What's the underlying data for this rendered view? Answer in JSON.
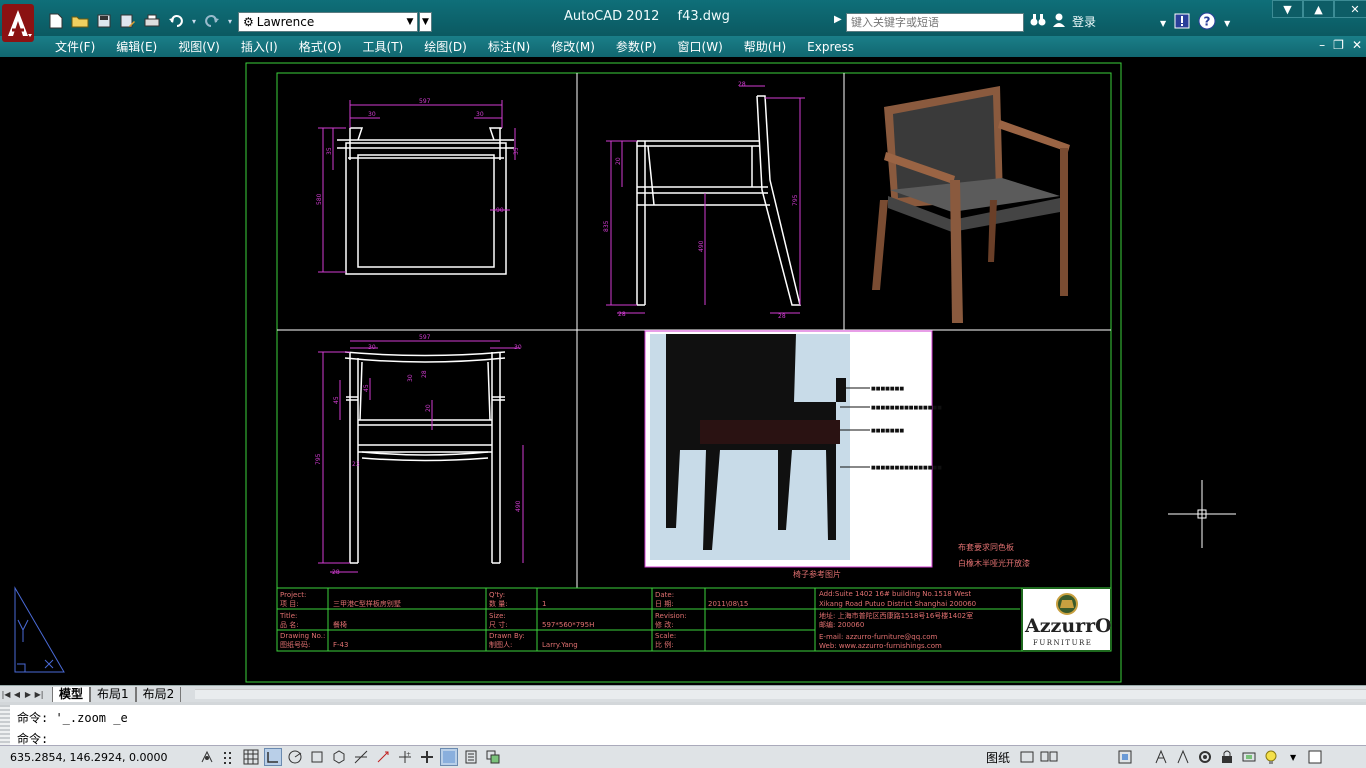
{
  "titlebar": {
    "app_name": "AutoCAD 2012",
    "file_name": "f43.dwg",
    "workspace": "Lawrence",
    "search_placeholder": "键入关键字或短语",
    "login_label": "登录"
  },
  "menu": {
    "items": [
      {
        "label": "文件(F)"
      },
      {
        "label": "编辑(E)"
      },
      {
        "label": "视图(V)"
      },
      {
        "label": "插入(I)"
      },
      {
        "label": "格式(O)"
      },
      {
        "label": "工具(T)"
      },
      {
        "label": "绘图(D)"
      },
      {
        "label": "标注(N)"
      },
      {
        "label": "修改(M)"
      },
      {
        "label": "参数(P)"
      },
      {
        "label": "窗口(W)"
      },
      {
        "label": "帮助(H)"
      },
      {
        "label": "Express"
      }
    ]
  },
  "drawing": {
    "dims": {
      "front_width": "597",
      "front_arm": "30",
      "front_side": "30",
      "front_height": "580",
      "front_top": "35",
      "front_right": "35",
      "front_inner": "90",
      "side_top": "28",
      "side_total": "835",
      "side_seat": "490",
      "side_right": "795",
      "side_upper": "20",
      "side_bottom1": "28",
      "side_bottom2": "28",
      "back_width": "597",
      "back_arm": "30",
      "back_right": "30",
      "back_height": "795",
      "back_low": "490",
      "back_a": "45",
      "back_b": "45",
      "back_c": "30",
      "back_d": "28",
      "back_e": "23",
      "back_f": "20",
      "back_g": "28"
    },
    "photo_callouts": [
      "■■■■■■■",
      "■■■■■■■■■■■■■■■",
      "■■■■■■■",
      "■■■■■■■■■■■■■■■"
    ],
    "photo_caption": "椅子参考图片",
    "notes": [
      "布套要求同色板",
      "白橡木半哑光开放漆"
    ],
    "title_block": {
      "project_en": "Project:",
      "project_cn": "项  目:",
      "project_value": "三甲港C型样板房别墅",
      "qty_en": "Q'ty:",
      "qty_cn": "数  量:",
      "qty_value": "1",
      "date_en": "Date:",
      "date_cn": "日  期:",
      "date_value": "2011\\08\\15",
      "title_en": "Title:",
      "title_cn": "品  名:",
      "title_value": "餐椅",
      "size_en": "Size:",
      "size_cn": "尺  寸:",
      "size_value": "597*560*795H",
      "revision_en": "Revision:",
      "revision_cn": "修  改:",
      "drawing_no_en": "Drawing No.:",
      "drawing_no_cn": "图纸号码:",
      "drawing_no_value": "F-43",
      "drawn_by_en": "Drawn By:",
      "drawn_by_cn": "制图人:",
      "drawn_by_value": "Larry.Yang",
      "scale_en": "Scale:",
      "scale_cn": "比  例:",
      "addr1": "Add:Suite 1402 16# building No.1518 West",
      "addr2": "Xikang Road Putuo District Shanghai 200060",
      "addr3": "地址: 上海市普陀区西康路1518号16号楼1402室",
      "addr4": "邮编: 200060",
      "email": "E-mail: azzurro-furniture@qq.com",
      "web": "Web: www.azzurro-furnishings.com",
      "logo_text": "AzzurrO",
      "logo_sub": "FURNITURE"
    }
  },
  "tabs": [
    {
      "label": "模型",
      "active": true
    },
    {
      "label": "布局1",
      "active": false
    },
    {
      "label": "布局2",
      "active": false
    }
  ],
  "command": {
    "history": "命令: '_.zoom _e",
    "prompt": "命令:"
  },
  "status": {
    "coords": "635.2854, 146.2924, 0.0000",
    "paper_label": "图纸"
  },
  "colors": {
    "cad_bg": "#000000",
    "frame": "#3cd23c",
    "dim": "#d23cd2",
    "annot": "#e07070"
  }
}
